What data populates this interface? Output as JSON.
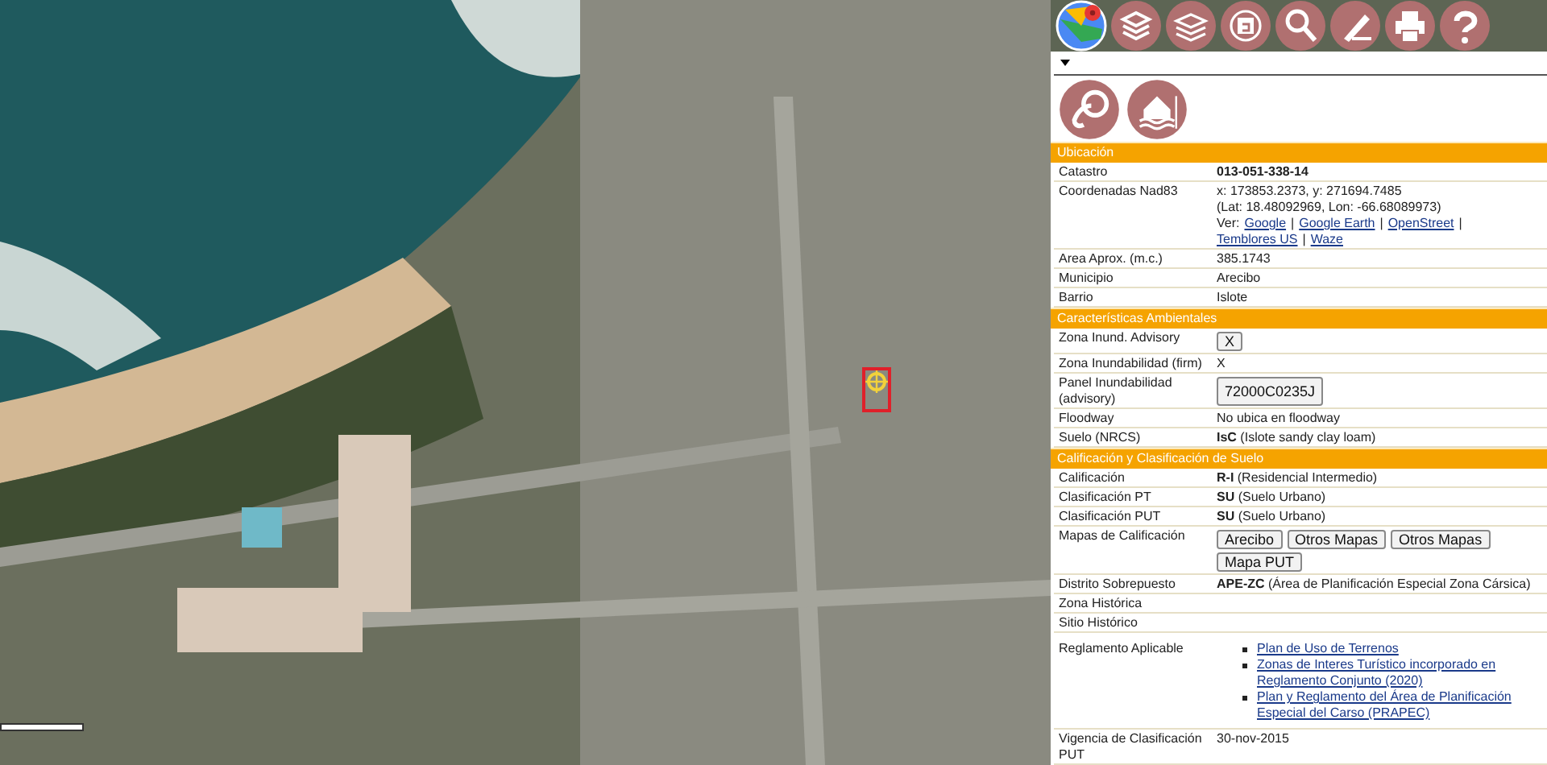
{
  "sections": [
    {
      "title": "Ubicación",
      "rows": [
        {
          "label": "Catastro",
          "kind": "bold",
          "value": "013-051-338-14"
        },
        {
          "label": "Coordenadas Nad83",
          "kind": "coords",
          "lines": [
            "x: 173853.2373, y: 271694.7485",
            "(Lat: 18.48092969, Lon: -66.68089973)"
          ],
          "prefix": "Ver:",
          "separator": "|",
          "links": [
            "Google",
            "Google Earth",
            "OpenStreet",
            "Temblores US",
            "Waze"
          ]
        },
        {
          "label": "Area Aprox. (m.c.)",
          "kind": "text",
          "value": "385.1743"
        },
        {
          "label": "Municipio",
          "kind": "text",
          "value": "Arecibo"
        },
        {
          "label": "Barrio",
          "kind": "text",
          "value": "Islote"
        }
      ]
    },
    {
      "title": "Características Ambientales",
      "rows": [
        {
          "label": "Zona Inund. Advisory",
          "kind": "buttons",
          "buttons": [
            "X"
          ]
        },
        {
          "label": "Zona Inundabilidad (firm)",
          "kind": "text",
          "value": "X"
        },
        {
          "label": "Panel Inundabilidad (advisory)",
          "kind": "buttons",
          "buttons": [
            "72000C0235J"
          ]
        },
        {
          "label": "Floodway",
          "kind": "text",
          "value": "No ubica en floodway"
        },
        {
          "label": "Suelo (NRCS)",
          "kind": "text",
          "value": "**IsC** (Islote sandy clay loam)"
        }
      ]
    },
    {
      "title": "Calificación y Clasificación de Suelo",
      "rows": [
        {
          "label": "Calificación",
          "kind": "text",
          "value": "**R-I** (Residencial Intermedio)"
        },
        {
          "label": "Clasificación PT",
          "kind": "text",
          "value": "**SU** (Suelo Urbano)"
        },
        {
          "label": "Clasificación PUT",
          "kind": "text",
          "value": "**SU** (Suelo Urbano)"
        },
        {
          "label": "Mapas de Calificación",
          "kind": "buttons",
          "buttons": [
            "Arecibo",
            "Otros Mapas",
            "Otros Mapas",
            "Mapa PUT"
          ]
        },
        {
          "label": "Distrito Sobrepuesto",
          "kind": "text",
          "value": "**APE-ZC** (Área de Planificación Especial Zona Cársica)"
        },
        {
          "label": "Zona Histórica",
          "kind": "text"
        },
        {
          "label": "Sitio Histórico",
          "kind": "text"
        },
        {
          "label": "Reglamento Aplicable",
          "kind": "links",
          "links": [
            "Plan de Uso de Terrenos",
            "Zonas de Interes Turístico incorporado en Reglamento Conjunto (2020)",
            "Plan y Reglamento del Área de Planificación Especial del Carso (PRAPEC)"
          ]
        },
        {
          "label": "Vigencia de Clasificación PUT",
          "kind": "text",
          "value": "30-nov-2015"
        }
      ]
    }
  ]
}
